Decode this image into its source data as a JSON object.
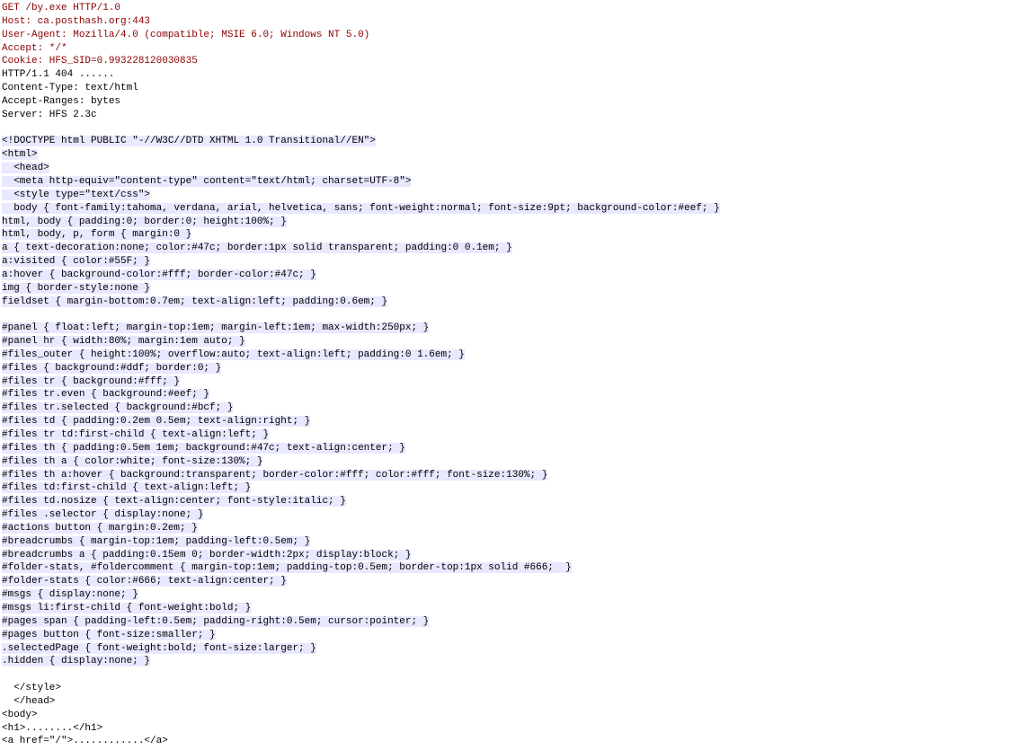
{
  "request": [
    "GET /by.exe HTTP/1.0",
    "Host: ca.posthash.org:443",
    "User-Agent: Mozilla/4.0 (compatible; MSIE 6.0; Windows NT 5.0)",
    "Accept: */*",
    "Cookie: HFS_SID=0.993228120030835",
    ""
  ],
  "response": [
    "HTTP/1.1 404 ......",
    "Content-Type: text/html",
    "Accept-Ranges: bytes",
    "Server: HFS 2.3c",
    "",
    ""
  ],
  "html_source": [
    "<!DOCTYPE html PUBLIC \"-//W3C//DTD XHTML 1.0 Transitional//EN\">",
    "<html>",
    "  <head>",
    "  <meta http-equiv=\"content-type\" content=\"text/html; charset=UTF-8\">",
    "  <style type=\"text/css\">",
    "  body { font-family:tahoma, verdana, arial, helvetica, sans; font-weight:normal; font-size:9pt; background-color:#eef; }",
    "html, body { padding:0; border:0; height:100%; }",
    "html, body, p, form { margin:0 }",
    "a { text-decoration:none; color:#47c; border:1px solid transparent; padding:0 0.1em; }",
    "a:visited { color:#55F; }",
    "a:hover { background-color:#fff; border-color:#47c; }",
    "img { border-style:none }",
    "fieldset { margin-bottom:0.7em; text-align:left; padding:0.6em; }",
    "",
    "#panel { float:left; margin-top:1em; margin-left:1em; max-width:250px; }",
    "#panel hr { width:80%; margin:1em auto; }",
    "#files_outer { height:100%; overflow:auto; text-align:left; padding:0 1.6em; }",
    "#files { background:#ddf; border:0; }",
    "#files tr { background:#fff; }",
    "#files tr.even { background:#eef; }",
    "#files tr.selected { background:#bcf; }",
    "#files td { padding:0.2em 0.5em; text-align:right; }",
    "#files tr td:first-child { text-align:left; }",
    "#files th { padding:0.5em 1em; background:#47c; text-align:center; }",
    "#files th a { color:white; font-size:130%; }",
    "#files th a:hover { background:transparent; border-color:#fff; color:#fff; font-size:130%; }",
    "#files td:first-child { text-align:left; }",
    "#files td.nosize { text-align:center; font-style:italic; }",
    "#files .selector { display:none; }",
    "#actions button { margin:0.2em; }",
    "#breadcrumbs { margin-top:1em; padding-left:0.5em; }",
    "#breadcrumbs a { padding:0.15em 0; border-width:2px; display:block; }",
    "#folder-stats, #foldercomment { margin-top:1em; padding-top:0.5em; border-top:1px solid #666;  }",
    "#folder-stats { color:#666; text-align:center; }",
    "#msgs { display:none; }",
    "#msgs li:first-child { font-weight:bold; }",
    "#pages span { padding-left:0.5em; padding-right:0.5em; cursor:pointer; }",
    "#pages button { font-size:smaller; }",
    ".selectedPage { font-weight:bold; font-size:larger; }",
    ".hidden { display:none; }",
    "",
    "  </style>",
    "  </head>",
    "<body>",
    "<h1>........</h1>",
    "<a href=\"/\">............</a>"
  ],
  "highlight_end_at": 40
}
